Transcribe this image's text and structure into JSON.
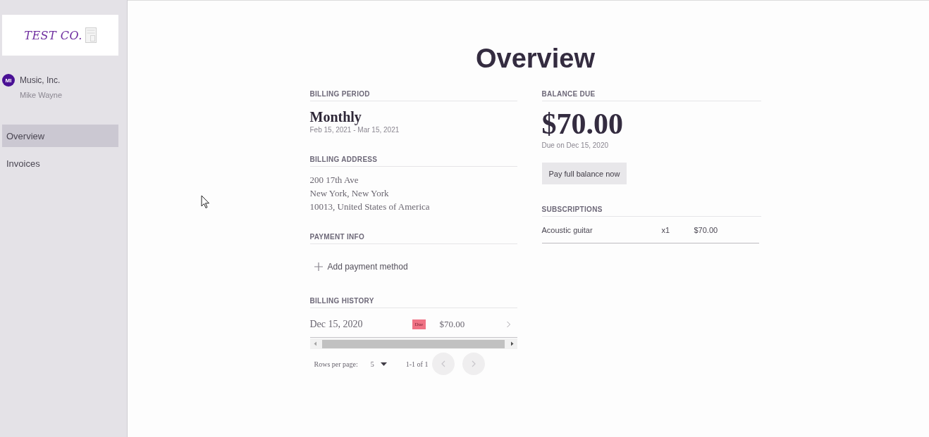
{
  "sidebar": {
    "logo": {
      "text": "TEST CO."
    },
    "account": {
      "initials": "MI",
      "company": "Music, Inc.",
      "user": "Mike Wayne"
    },
    "nav": [
      {
        "label": "Overview",
        "selected": true
      },
      {
        "label": "Invoices",
        "selected": false
      }
    ]
  },
  "page": {
    "title": "Overview"
  },
  "billing_period": {
    "heading": "BILLING PERIOD",
    "plan": "Monthly",
    "range": "Feb 15, 2021 - Mar 15, 2021"
  },
  "billing_address": {
    "heading": "BILLING ADDRESS",
    "lines": [
      "200 17th Ave",
      "New York, New York",
      "10013, United States of America"
    ]
  },
  "payment_info": {
    "heading": "PAYMENT INFO",
    "add_label": "Add payment method"
  },
  "billing_history": {
    "heading": "BILLING HISTORY",
    "rows": [
      {
        "date": "Dec 15, 2020",
        "status": "Due",
        "color": "#f07385",
        "amount": "$70.00"
      }
    ],
    "pagination": {
      "rows_label": "Rows per page:",
      "rows_value": "5",
      "range": "1-1 of 1",
      "previous": {
        "disabled": true
      },
      "next": {
        "disabled": true
      }
    }
  },
  "balance_due": {
    "heading": "BALANCE DUE",
    "amount": "$70.00",
    "due_note": "Due on Dec 15, 2020",
    "pay_button": "Pay full balance now"
  },
  "subscriptions": {
    "heading": "SUBSCRIPTIONS",
    "rows": [
      {
        "name": "Acoustic guitar",
        "quantity": "x1",
        "price": "$70.00"
      }
    ]
  }
}
